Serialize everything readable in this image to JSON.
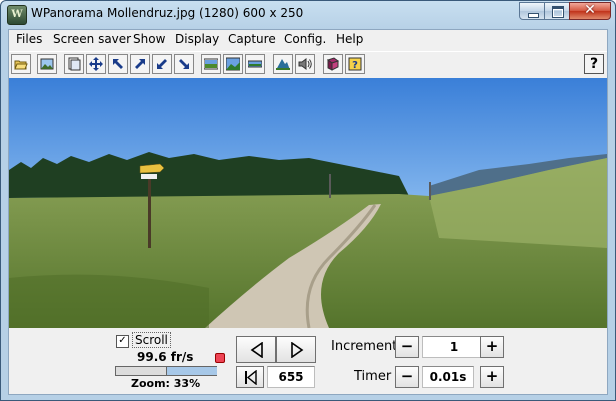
{
  "window": {
    "title": "WPanorama  Mollendruz.jpg   (1280) 600 x 250",
    "app_icon_letter": "W",
    "close_glyph": "✕"
  },
  "menu": [
    "Files",
    "Screen saver",
    "Show",
    "Display",
    "Capture",
    "Config.",
    "Help"
  ],
  "toolbar": {
    "icons": [
      "open-file-icon",
      "picture-icon",
      "pages-icon",
      "move-icon",
      "arrow-upleft-icon",
      "arrow-upright-icon",
      "arrow-downleft-icon",
      "arrow-downright-icon",
      "panorama-view-icon",
      "panorama-view-2-icon",
      "panorama-view-3-icon",
      "landscape-icon",
      "sound-icon",
      "book-icon",
      "help-card-icon"
    ],
    "help_label": "?"
  },
  "controls": {
    "scroll_label": "Scroll",
    "scroll_checked": true,
    "check_mark": "✓",
    "fps": "99.6 fr/s",
    "zoom_text": "Zoom: 33%",
    "zoom_fraction": 0.5,
    "position_value": "655",
    "increment_label": "Increment",
    "increment_value": "1",
    "timer_label": "Timer",
    "timer_value": "0.01s",
    "minus": "−",
    "plus": "+"
  },
  "colors": {
    "sky": "#5b9be0",
    "grass": "#7d9a44",
    "path": "#cfc6b4",
    "title_bar": "#b6d0e6"
  }
}
